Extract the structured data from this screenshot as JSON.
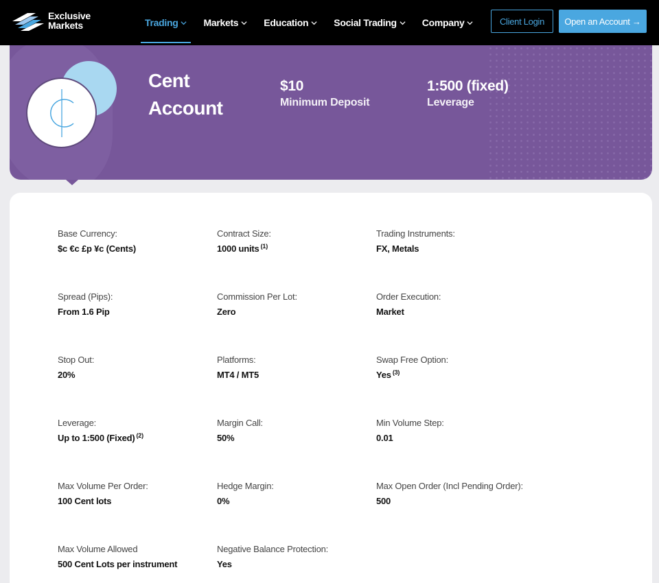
{
  "nav": {
    "logo": {
      "line1": "Exclusive",
      "line2": "Markets"
    },
    "menu": [
      {
        "label": "Trading",
        "active": true
      },
      {
        "label": "Markets",
        "active": false
      },
      {
        "label": "Education",
        "active": false
      },
      {
        "label": "Social Trading",
        "active": false
      },
      {
        "label": "Company",
        "active": false
      }
    ],
    "client_login": "Client Login",
    "open_account": "Open an Account →"
  },
  "hero": {
    "title_line1": "Cent",
    "title_line2": "Account",
    "deposit_value": "$10",
    "deposit_label": "Minimum Deposit",
    "leverage_value": "1:500 (fixed)",
    "leverage_label": "Leverage"
  },
  "specs": [
    {
      "label": "Base Currency:",
      "value": "$c €c £p ¥c (Cents)",
      "note": ""
    },
    {
      "label": "Contract Size:",
      "value": "1000 units",
      "note": "(1)"
    },
    {
      "label": "Trading Instruments:",
      "value": "FX, Metals",
      "note": ""
    },
    {
      "label": "Spread (Pips):",
      "value": "From 1.6 Pip",
      "note": ""
    },
    {
      "label": "Commission Per Lot:",
      "value": "Zero",
      "note": ""
    },
    {
      "label": "Order Execution:",
      "value": "Market",
      "note": ""
    },
    {
      "label": "Stop Out:",
      "value": "20%",
      "note": ""
    },
    {
      "label": "Platforms:",
      "value": "MT4 / MT5",
      "note": ""
    },
    {
      "label": "Swap Free Option:",
      "value": "Yes",
      "note": "(3)"
    },
    {
      "label": "Leverage:",
      "value": "Up to 1:500 (Fixed)",
      "note": "(2)"
    },
    {
      "label": "Margin Call:",
      "value": "50%",
      "note": ""
    },
    {
      "label": "Min Volume Step:",
      "value": "0.01",
      "note": ""
    },
    {
      "label": "Max Volume Per Order:",
      "value": "100 Cent lots",
      "note": ""
    },
    {
      "label": "Hedge Margin:",
      "value": "0%",
      "note": ""
    },
    {
      "label": "Max Open Order (Incl Pending Order):",
      "value": "500",
      "note": ""
    },
    {
      "label": "Max Volume Allowed",
      "value": "500 Cent Lots per instrument",
      "note": ""
    },
    {
      "label": "Negative Balance Protection:",
      "value": "Yes",
      "note": ""
    }
  ],
  "colors": {
    "accent": "#4aa7e0",
    "hero_purple": "#77579a",
    "nav_bg": "#000000"
  }
}
